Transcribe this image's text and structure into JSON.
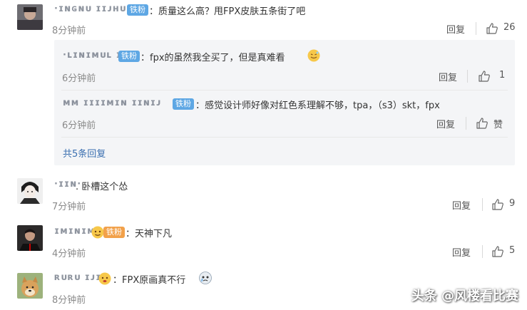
{
  "comments": [
    {
      "name": "·ɪɴɢɴᴜ ɪɪᴊʜᴜɪ",
      "badge": "铁粉",
      "text": "：质量这么高？甩FPX皮肤五条街了吧",
      "time": "8分钟前",
      "reply_label": "回复",
      "likes": "26",
      "nested": [
        {
          "name": "·ʟɪɴɪᴍᴜʟ ɪᴜʟ",
          "badge": "铁粉",
          "text": "：fpx的虽然我全买了，但是真难看",
          "time": "6分钟前",
          "reply_label": "回复",
          "likes": "1"
        },
        {
          "name": "ᴍᴍ ɪɪɪɪᴍɪɴ ɪɪɴɪᴊ",
          "badge": "铁粉",
          "text": "：感觉设计师好像对红色系理解不够，tpa，（s3）skt，fpx",
          "time": "6分钟前",
          "reply_label": "回复",
          "likes": "赞"
        }
      ],
      "more_label": "共5条回复"
    },
    {
      "name": "·ɪɪɴ·",
      "text": ". 卧槽这个怂",
      "time": "7分钟前",
      "reply_label": "回复",
      "likes": "9"
    },
    {
      "name": "ɪᴍɪɴɪᴍ",
      "badge": "铁粉",
      "text": "：天神下凡",
      "time": "4分钟前",
      "reply_label": "回复",
      "likes": "5"
    },
    {
      "name": "ʀᴜʀᴜ ɪᴊɪ",
      "text": "：FPX原画真不行",
      "time": "8分钟前"
    }
  ],
  "watermark": "头条 @风楼看比赛",
  "colors": {
    "badge_blue": "#5ea7e4",
    "badge_gold": "#f2a14a",
    "link_blue": "#3a6fb0",
    "nested_bg": "#f4f5f7"
  }
}
